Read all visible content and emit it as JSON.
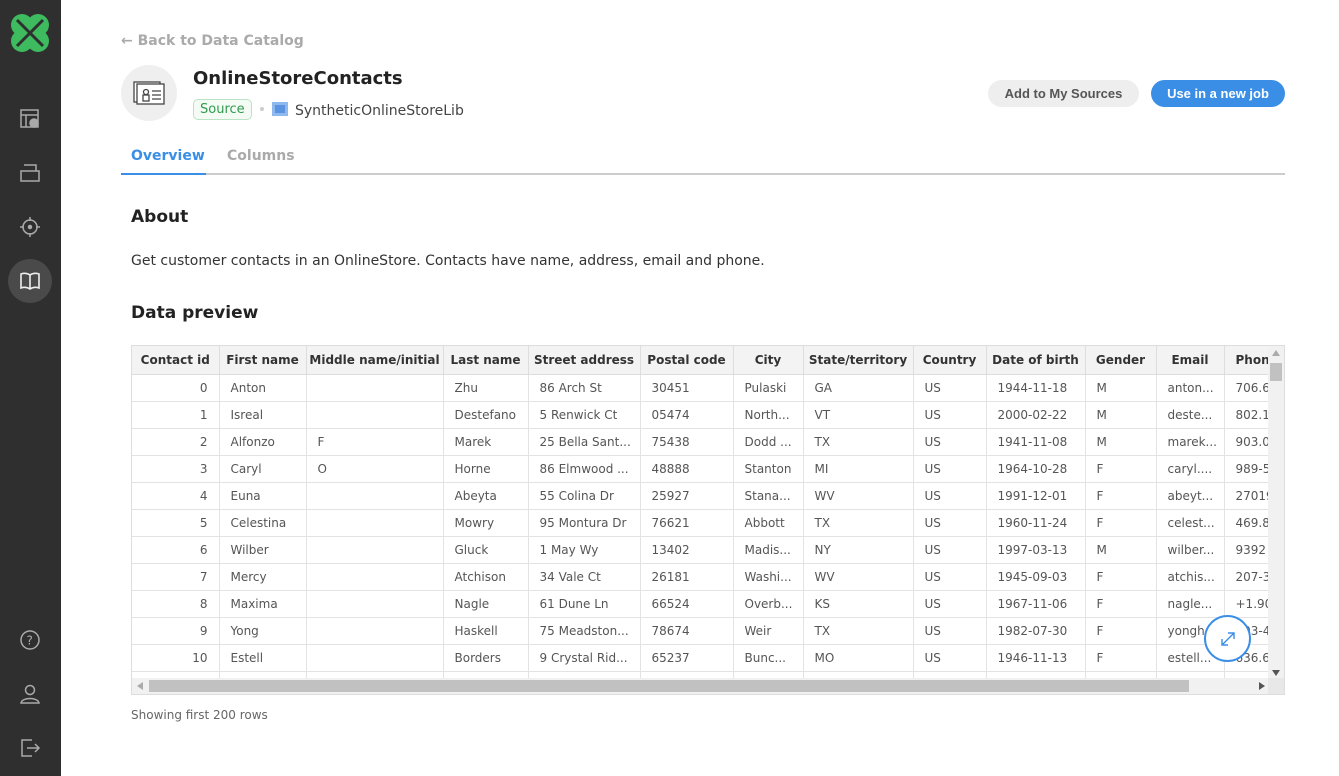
{
  "nav": {
    "back_label": "← Back to Data Catalog"
  },
  "header": {
    "title": "OnlineStoreContacts",
    "badge": "Source",
    "library": "SyntheticOnlineStoreLib",
    "add_button": "Add to My Sources",
    "use_button": "Use in a new job"
  },
  "tabs": [
    {
      "label": "Overview",
      "active": true
    },
    {
      "label": "Columns",
      "active": false
    }
  ],
  "about": {
    "heading": "About",
    "text": "Get customer contacts in an OnlineStore. Contacts have name, address, email and phone."
  },
  "preview": {
    "heading": "Data preview",
    "footer": "Showing first 200 rows",
    "columns": [
      "Contact id",
      "First name",
      "Middle name/initial",
      "Last name",
      "Street address",
      "Postal code",
      "City",
      "State/territory",
      "Country",
      "Date of birth",
      "Gender",
      "Email",
      "Phon"
    ],
    "rows": [
      [
        "0",
        "Anton",
        "",
        "Zhu",
        "86 Arch St",
        "30451",
        "Pulaski",
        "GA",
        "US",
        "1944-11-18",
        "M",
        "anton...",
        "706.6"
      ],
      [
        "1",
        "Isreal",
        "",
        "Destefano",
        "5 Renwick Ct",
        "05474",
        "North...",
        "VT",
        "US",
        "2000-02-22",
        "M",
        "deste...",
        "802.1"
      ],
      [
        "2",
        "Alfonzo",
        "F",
        "Marek",
        "25 Bella Sant...",
        "75438",
        "Dodd ...",
        "TX",
        "US",
        "1941-11-08",
        "M",
        "marek...",
        "903.0"
      ],
      [
        "3",
        "Caryl",
        "O",
        "Horne",
        "86 Elmwood ...",
        "48888",
        "Stanton",
        "MI",
        "US",
        "1964-10-28",
        "F",
        "caryl....",
        "989-5"
      ],
      [
        "4",
        "Euna",
        "",
        "Abeyta",
        "55 Colina Dr",
        "25927",
        "Stana...",
        "WV",
        "US",
        "1991-12-01",
        "F",
        "abeyt...",
        "27019"
      ],
      [
        "5",
        "Celestina",
        "",
        "Mowry",
        "95 Montura Dr",
        "76621",
        "Abbott",
        "TX",
        "US",
        "1960-11-24",
        "F",
        "celest...",
        "469.8"
      ],
      [
        "6",
        "Wilber",
        "",
        "Gluck",
        "1 May Wy",
        "13402",
        "Madis...",
        "NY",
        "US",
        "1997-03-13",
        "M",
        "wilber...",
        "9392"
      ],
      [
        "7",
        "Mercy",
        "",
        "Atchison",
        "34 Vale Ct",
        "26181",
        "Washi...",
        "WV",
        "US",
        "1945-09-03",
        "F",
        "atchis...",
        "207-3"
      ],
      [
        "8",
        "Maxima",
        "",
        "Nagle",
        "61 Dune Ln",
        "66524",
        "Overb...",
        "KS",
        "US",
        "1967-11-06",
        "F",
        "nagle...",
        "+1.90"
      ],
      [
        "9",
        "Yong",
        "",
        "Haskell",
        "75 Meadston...",
        "78674",
        "Weir",
        "TX",
        "US",
        "1982-07-30",
        "F",
        "yongh...",
        "903-4"
      ],
      [
        "10",
        "Estell",
        "",
        "Borders",
        "9 Crystal Rid...",
        "65237",
        "Bunc...",
        "MO",
        "US",
        "1946-11-13",
        "F",
        "estell...",
        "636.6"
      ]
    ]
  },
  "colors": {
    "accent": "#3a8ee6",
    "sidebar": "#2f2f2f",
    "brand": "#3dbb5e"
  }
}
